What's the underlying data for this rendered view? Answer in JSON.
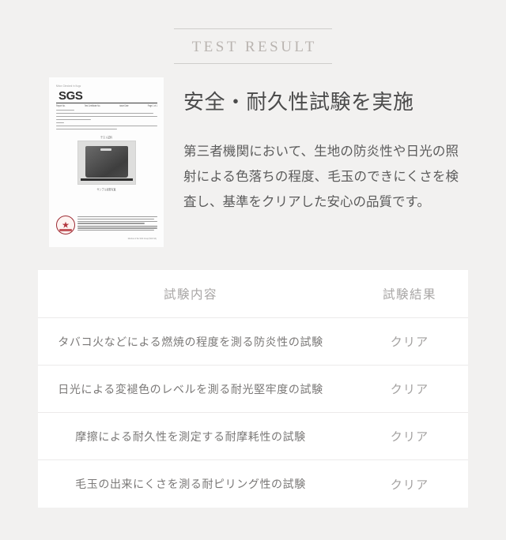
{
  "section": {
    "eyebrow": "TEST RESULT",
    "headline": "安全・耐久性試験を実施",
    "body": "第三者機関において、生地の防炎性や日光の照射による色落ちの程度、毛玉のできにくさを検査し、基準をクリアした安心の品質です。"
  },
  "certificate": {
    "header_text": "Nihon Checked in Kogo",
    "logo": "SGS",
    "meta": [
      "Report No.",
      "Test Certificate No.",
      "Issue Date",
      "Page 1 of 1"
    ],
    "photo_caption_top": "テスト試料",
    "photo_caption_bottom": "サンプル状態写真",
    "footer_note": "Member of the SGS Group (SGS SA)"
  },
  "table": {
    "headers": {
      "name": "試験内容",
      "result": "試験結果"
    },
    "rows": [
      {
        "name": "タバコ火などによる燃焼の程度を測る防炎性の試験",
        "result": "クリア"
      },
      {
        "name": "日光による変褪色のレベルを測る耐光堅牢度の試験",
        "result": "クリア"
      },
      {
        "name": "摩擦による耐久性を測定する耐摩耗性の試験",
        "result": "クリア"
      },
      {
        "name": "毛玉の出来にくさを測る耐ピリング性の試験",
        "result": "クリア"
      }
    ]
  },
  "colors": {
    "page_background": "#f2f1f0",
    "card_background": "#ffffff",
    "eyebrow_text": "#b9b4b0",
    "headline_text": "#4b4b4b",
    "body_text": "#5c5c5c",
    "row_divider": "#eceaea",
    "seal_red": "#9d2b33"
  }
}
